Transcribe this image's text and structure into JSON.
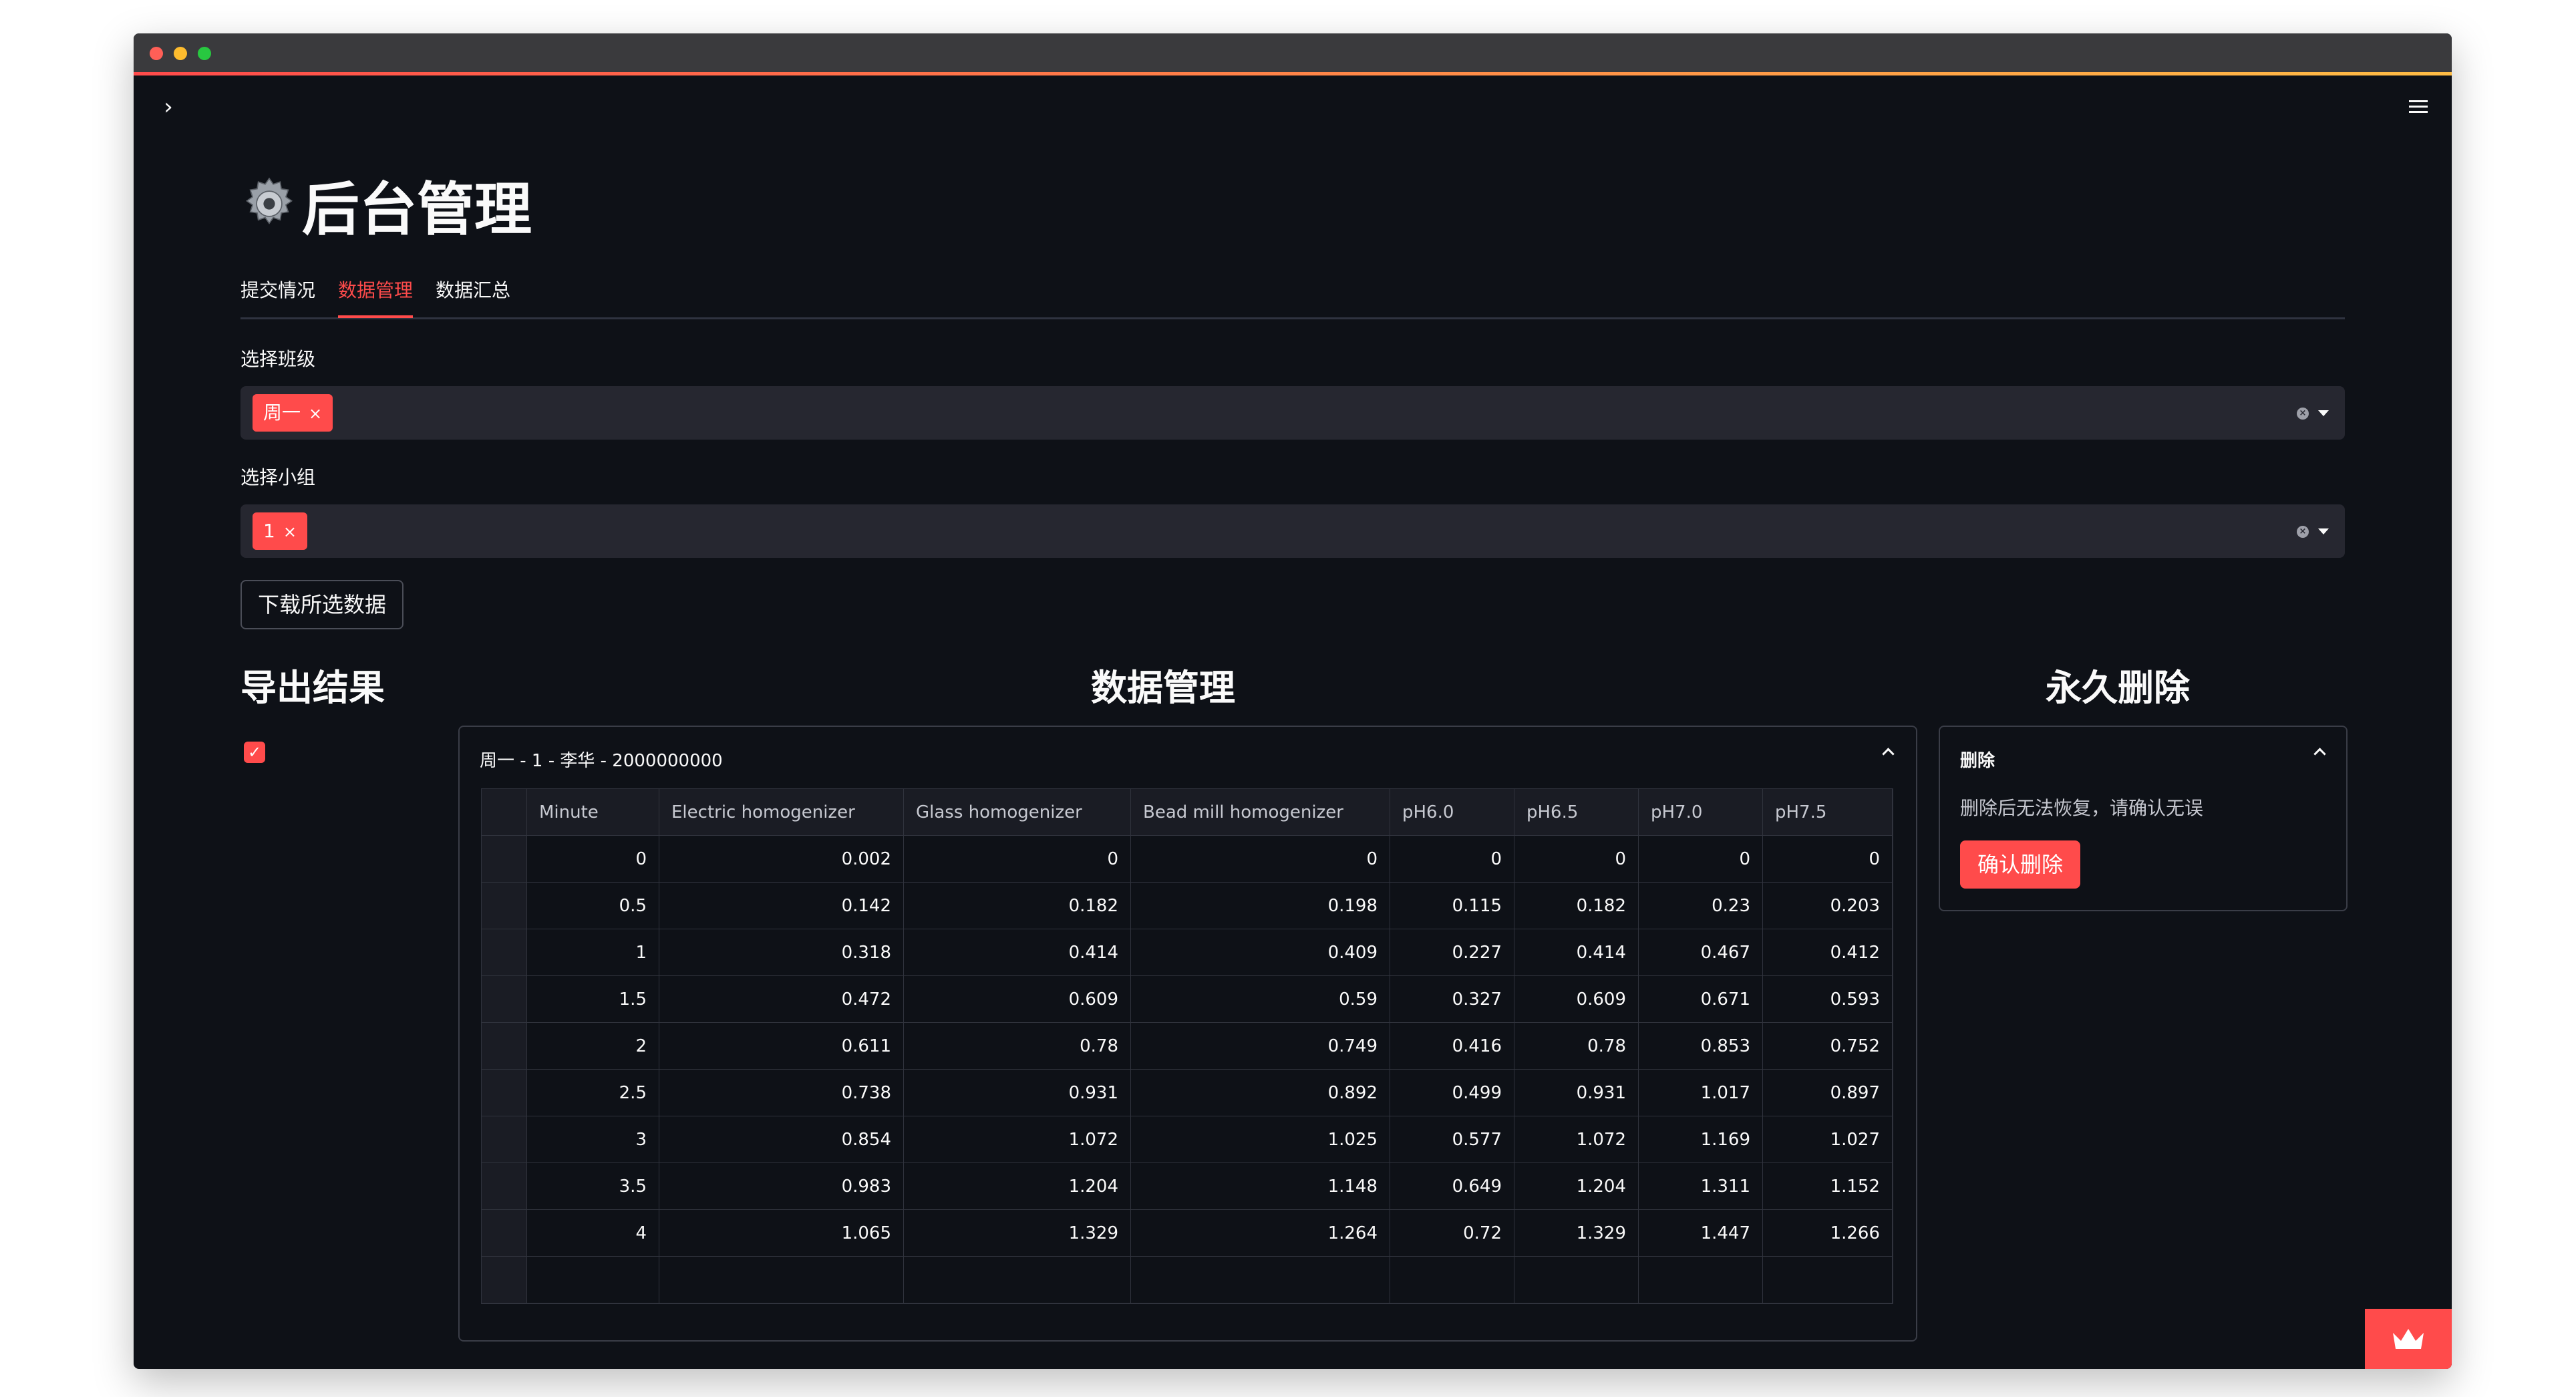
{
  "header": {
    "title": "后台管理"
  },
  "tabs": [
    {
      "label": "提交情况",
      "active": false
    },
    {
      "label": "数据管理",
      "active": true
    },
    {
      "label": "数据汇总",
      "active": false
    }
  ],
  "filters": {
    "class_label": "选择班级",
    "class_chip": "周一",
    "group_label": "选择小组",
    "group_chip": "1",
    "remove_glyph": "×"
  },
  "download_button": "下载所选数据",
  "sections": {
    "export": "导出结果",
    "manage": "数据管理",
    "delete": "永久删除"
  },
  "export_checkbox_checked": true,
  "data_expander": {
    "title": "周一 - 1 - 李华 - 2000000000",
    "columns": [
      "Minute",
      "Electric homogenizer",
      "Glass homogenizer",
      "Bead mill homogenizer",
      "pH6.0",
      "pH6.5",
      "pH7.0",
      "pH7.5"
    ],
    "rows": [
      [
        "0",
        "0.002",
        "0",
        "0",
        "0",
        "0",
        "0",
        "0"
      ],
      [
        "0.5",
        "0.142",
        "0.182",
        "0.198",
        "0.115",
        "0.182",
        "0.23",
        "0.203"
      ],
      [
        "1",
        "0.318",
        "0.414",
        "0.409",
        "0.227",
        "0.414",
        "0.467",
        "0.412"
      ],
      [
        "1.5",
        "0.472",
        "0.609",
        "0.59",
        "0.327",
        "0.609",
        "0.671",
        "0.593"
      ],
      [
        "2",
        "0.611",
        "0.78",
        "0.749",
        "0.416",
        "0.78",
        "0.853",
        "0.752"
      ],
      [
        "2.5",
        "0.738",
        "0.931",
        "0.892",
        "0.499",
        "0.931",
        "1.017",
        "0.897"
      ],
      [
        "3",
        "0.854",
        "1.072",
        "1.025",
        "0.577",
        "1.072",
        "1.169",
        "1.027"
      ],
      [
        "3.5",
        "0.983",
        "1.204",
        "1.148",
        "0.649",
        "1.204",
        "1.311",
        "1.152"
      ],
      [
        "4",
        "1.065",
        "1.329",
        "1.264",
        "0.72",
        "1.329",
        "1.447",
        "1.266"
      ]
    ]
  },
  "delete_expander": {
    "title": "删除",
    "description": "删除后无法恢复，请确认无误",
    "confirm_button": "确认删除"
  },
  "colors": {
    "accent": "#ff4b4b",
    "background": "#0e1117",
    "widget": "#262730"
  },
  "icons": {
    "title": "gear-icon",
    "sidebar": "chevron-right-icon",
    "menu": "hamburger-menu-icon",
    "deploy": "crown-icon"
  }
}
